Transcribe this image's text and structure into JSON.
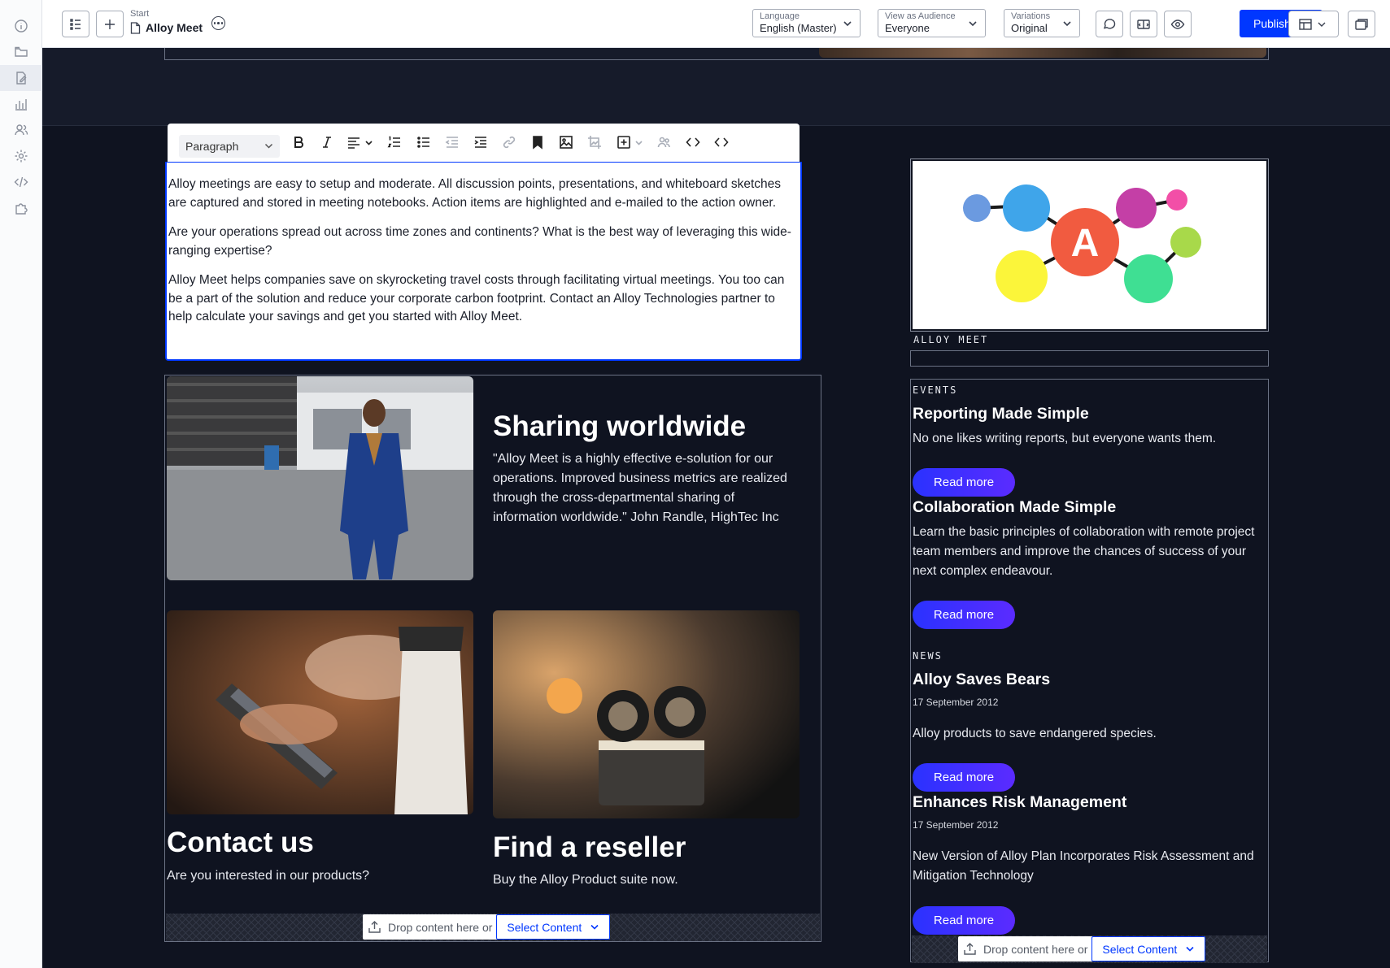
{
  "topbar": {
    "breadcrumb_start": "Start",
    "page_title": "Alloy Meet",
    "language": {
      "label": "Language",
      "value": "English (Master)"
    },
    "audience": {
      "label": "View as Audience",
      "value": "Everyone"
    },
    "variations": {
      "label": "Variations",
      "value": "Original"
    },
    "publish_label": "Publish"
  },
  "editor": {
    "block_format": "Paragraph",
    "paragraphs": [
      "Alloy meetings are easy to setup and moderate. All discussion points, presentations, and whiteboard sketches are captured and stored in meeting notebooks. Action items are highlighted and e-mailed to the action owner.",
      "Are your operations spread out across time zones and continents? What is the best way of leveraging this wide-ranging expertise?",
      "Alloy Meet helps companies save on skyrocketing travel costs through facilitating virtual meetings. You too can be a part of the solution and reduce your corporate carbon footprint. Contact an Alloy Technologies partner to help calculate your savings and get you started with Alloy Meet."
    ]
  },
  "blocks": {
    "sharing": {
      "title": "Sharing worldwide",
      "text": "\"Alloy Meet is a highly effective e-solution for our operations. Improved business metrics are realized through the cross-departmental sharing of information worldwide.\" John Randle, HighTec Inc"
    },
    "contact": {
      "title": "Contact us",
      "text": "Are you interested in our products?"
    },
    "reseller": {
      "title": "Find a reseller",
      "text": "Buy the Alloy Product suite now."
    }
  },
  "dropzone": {
    "text": "Drop content here or",
    "select_label": "Select Content"
  },
  "sidebar": {
    "image_caption": "ALLOY MEET",
    "logo_letter": "A",
    "events_heading": "EVENTS",
    "news_heading": "NEWS",
    "read_more": "Read more",
    "events": [
      {
        "title": "Reporting Made Simple",
        "text": "No one likes writing reports, but everyone wants them."
      },
      {
        "title": "Collaboration Made Simple",
        "text": "Learn the basic principles of collaboration with remote project team members and improve the chances of success of your next complex endeavour."
      }
    ],
    "news": [
      {
        "title": "Alloy Saves Bears",
        "date": "17 September 2012",
        "text": "Alloy products to save endangered species."
      },
      {
        "title": "Enhances Risk Management",
        "date": "17 September 2012",
        "text": "New Version of Alloy Plan Incorporates Risk Assessment and Mitigation Technology"
      }
    ]
  },
  "colors": {
    "accent": "#0037ff",
    "canvas": "#0f1320",
    "button_gradient_start": "#2a32ff",
    "button_gradient_end": "#5b2bff"
  }
}
